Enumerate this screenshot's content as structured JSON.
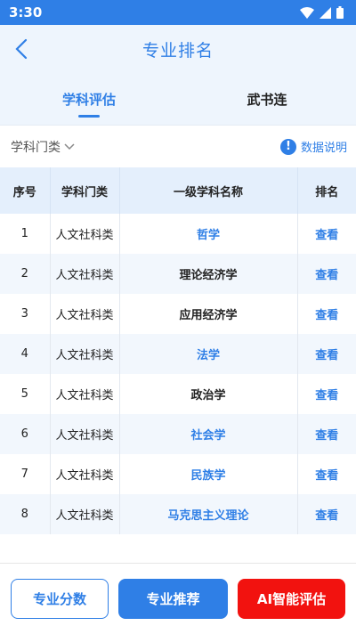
{
  "status_bar": {
    "time": "3:30"
  },
  "header": {
    "title": "专业排名"
  },
  "tabs": [
    {
      "label": "学科评估",
      "active": true
    },
    {
      "label": "武书连",
      "active": false
    }
  ],
  "filter": {
    "category_label": "学科门类",
    "info_label": "数据说明"
  },
  "table": {
    "headers": [
      "序号",
      "学科门类",
      "一级学科名称",
      "排名"
    ],
    "rows": [
      {
        "no": "1",
        "category": "人文社科类",
        "name": "哲学",
        "action": "查看",
        "link": true
      },
      {
        "no": "2",
        "category": "人文社科类",
        "name": "理论经济学",
        "action": "查看",
        "link": false
      },
      {
        "no": "3",
        "category": "人文社科类",
        "name": "应用经济学",
        "action": "查看",
        "link": false
      },
      {
        "no": "4",
        "category": "人文社科类",
        "name": "法学",
        "action": "查看",
        "link": true
      },
      {
        "no": "5",
        "category": "人文社科类",
        "name": "政治学",
        "action": "查看",
        "link": false
      },
      {
        "no": "6",
        "category": "人文社科类",
        "name": "社会学",
        "action": "查看",
        "link": true
      },
      {
        "no": "7",
        "category": "人文社科类",
        "name": "民族学",
        "action": "查看",
        "link": true
      },
      {
        "no": "8",
        "category": "人文社科类",
        "name": "马克思主义理论",
        "action": "查看",
        "link": true
      }
    ]
  },
  "bottom_buttons": {
    "score": "专业分数",
    "recommend": "专业推荐",
    "ai": "AI智能评估"
  },
  "colors": {
    "accent": "#2f7fe6",
    "ai_button": "#f2120f"
  }
}
